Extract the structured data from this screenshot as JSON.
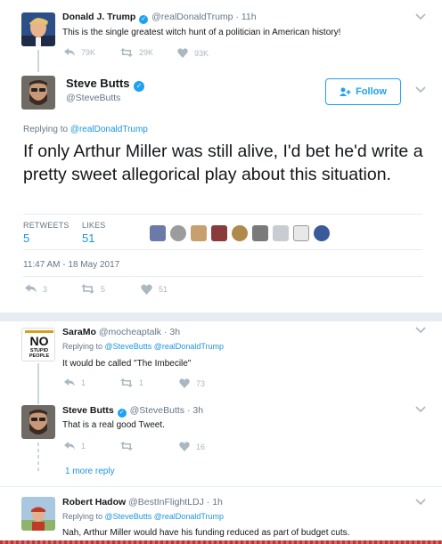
{
  "trump_tweet": {
    "name": "Donald J. Trump",
    "screen_name": "@realDonaldTrump",
    "separator": "·",
    "time": "11h",
    "text": "This is the single greatest witch hunt of a politician in American history!",
    "retweets": "29K",
    "likes": "93K",
    "replies": "79K"
  },
  "main_tweet": {
    "name": "Steve Butts",
    "screen_name": "@SteveButts",
    "follow_label": "Follow",
    "replying_prefix": "Replying to",
    "replying_to": "@realDonaldTrump",
    "text": "If only Arthur Miller was still alive, I'd bet he'd write a pretty sweet allegorical play about this situation.",
    "retweets_label": "RETWEETS",
    "retweets_value": "5",
    "likes_label": "LIKES",
    "likes_value": "51",
    "timestamp": "11:47 AM - 18 May 2017",
    "replies": "3",
    "retweets_action": "5",
    "likes_action": "51"
  },
  "reply_1": {
    "name": "SaraMo",
    "screen_name": "@mocheaptalk",
    "separator": "·",
    "time": "3h",
    "replying_prefix": "Replying to",
    "replying_to": "@SteveButts @realDonaldTrump",
    "text": "It would be called \"The Imbecile\"",
    "replies": "1",
    "retweets": "1",
    "likes": "73",
    "avatar_text_1": "NO",
    "avatar_text_2": "STUPID",
    "avatar_text_3": "PEOPLE"
  },
  "reply_2": {
    "name": "Steve Butts",
    "screen_name": "@SteveButts",
    "separator": "·",
    "time": "3h",
    "text": "That is a real good Tweet.",
    "replies": "1",
    "retweets": "",
    "likes": "16"
  },
  "more_replies_label": "1 more reply",
  "reply_3": {
    "name": "Robert Hadow",
    "screen_name": "@BestInFlightLDJ",
    "separator": "·",
    "time": "1h",
    "replying_prefix": "Replying to",
    "replying_to": "@SteveButts @realDonaldTrump",
    "text": "Nah, Arthur Miller would have his funding reduced as part of budget cuts."
  },
  "colors": {
    "twitter_blue": "#1da1f2",
    "link_blue": "#1b95e0",
    "muted_grey": "#657786",
    "icon_grey": "#aab8c2",
    "thread_line": "#ccd6dd"
  }
}
